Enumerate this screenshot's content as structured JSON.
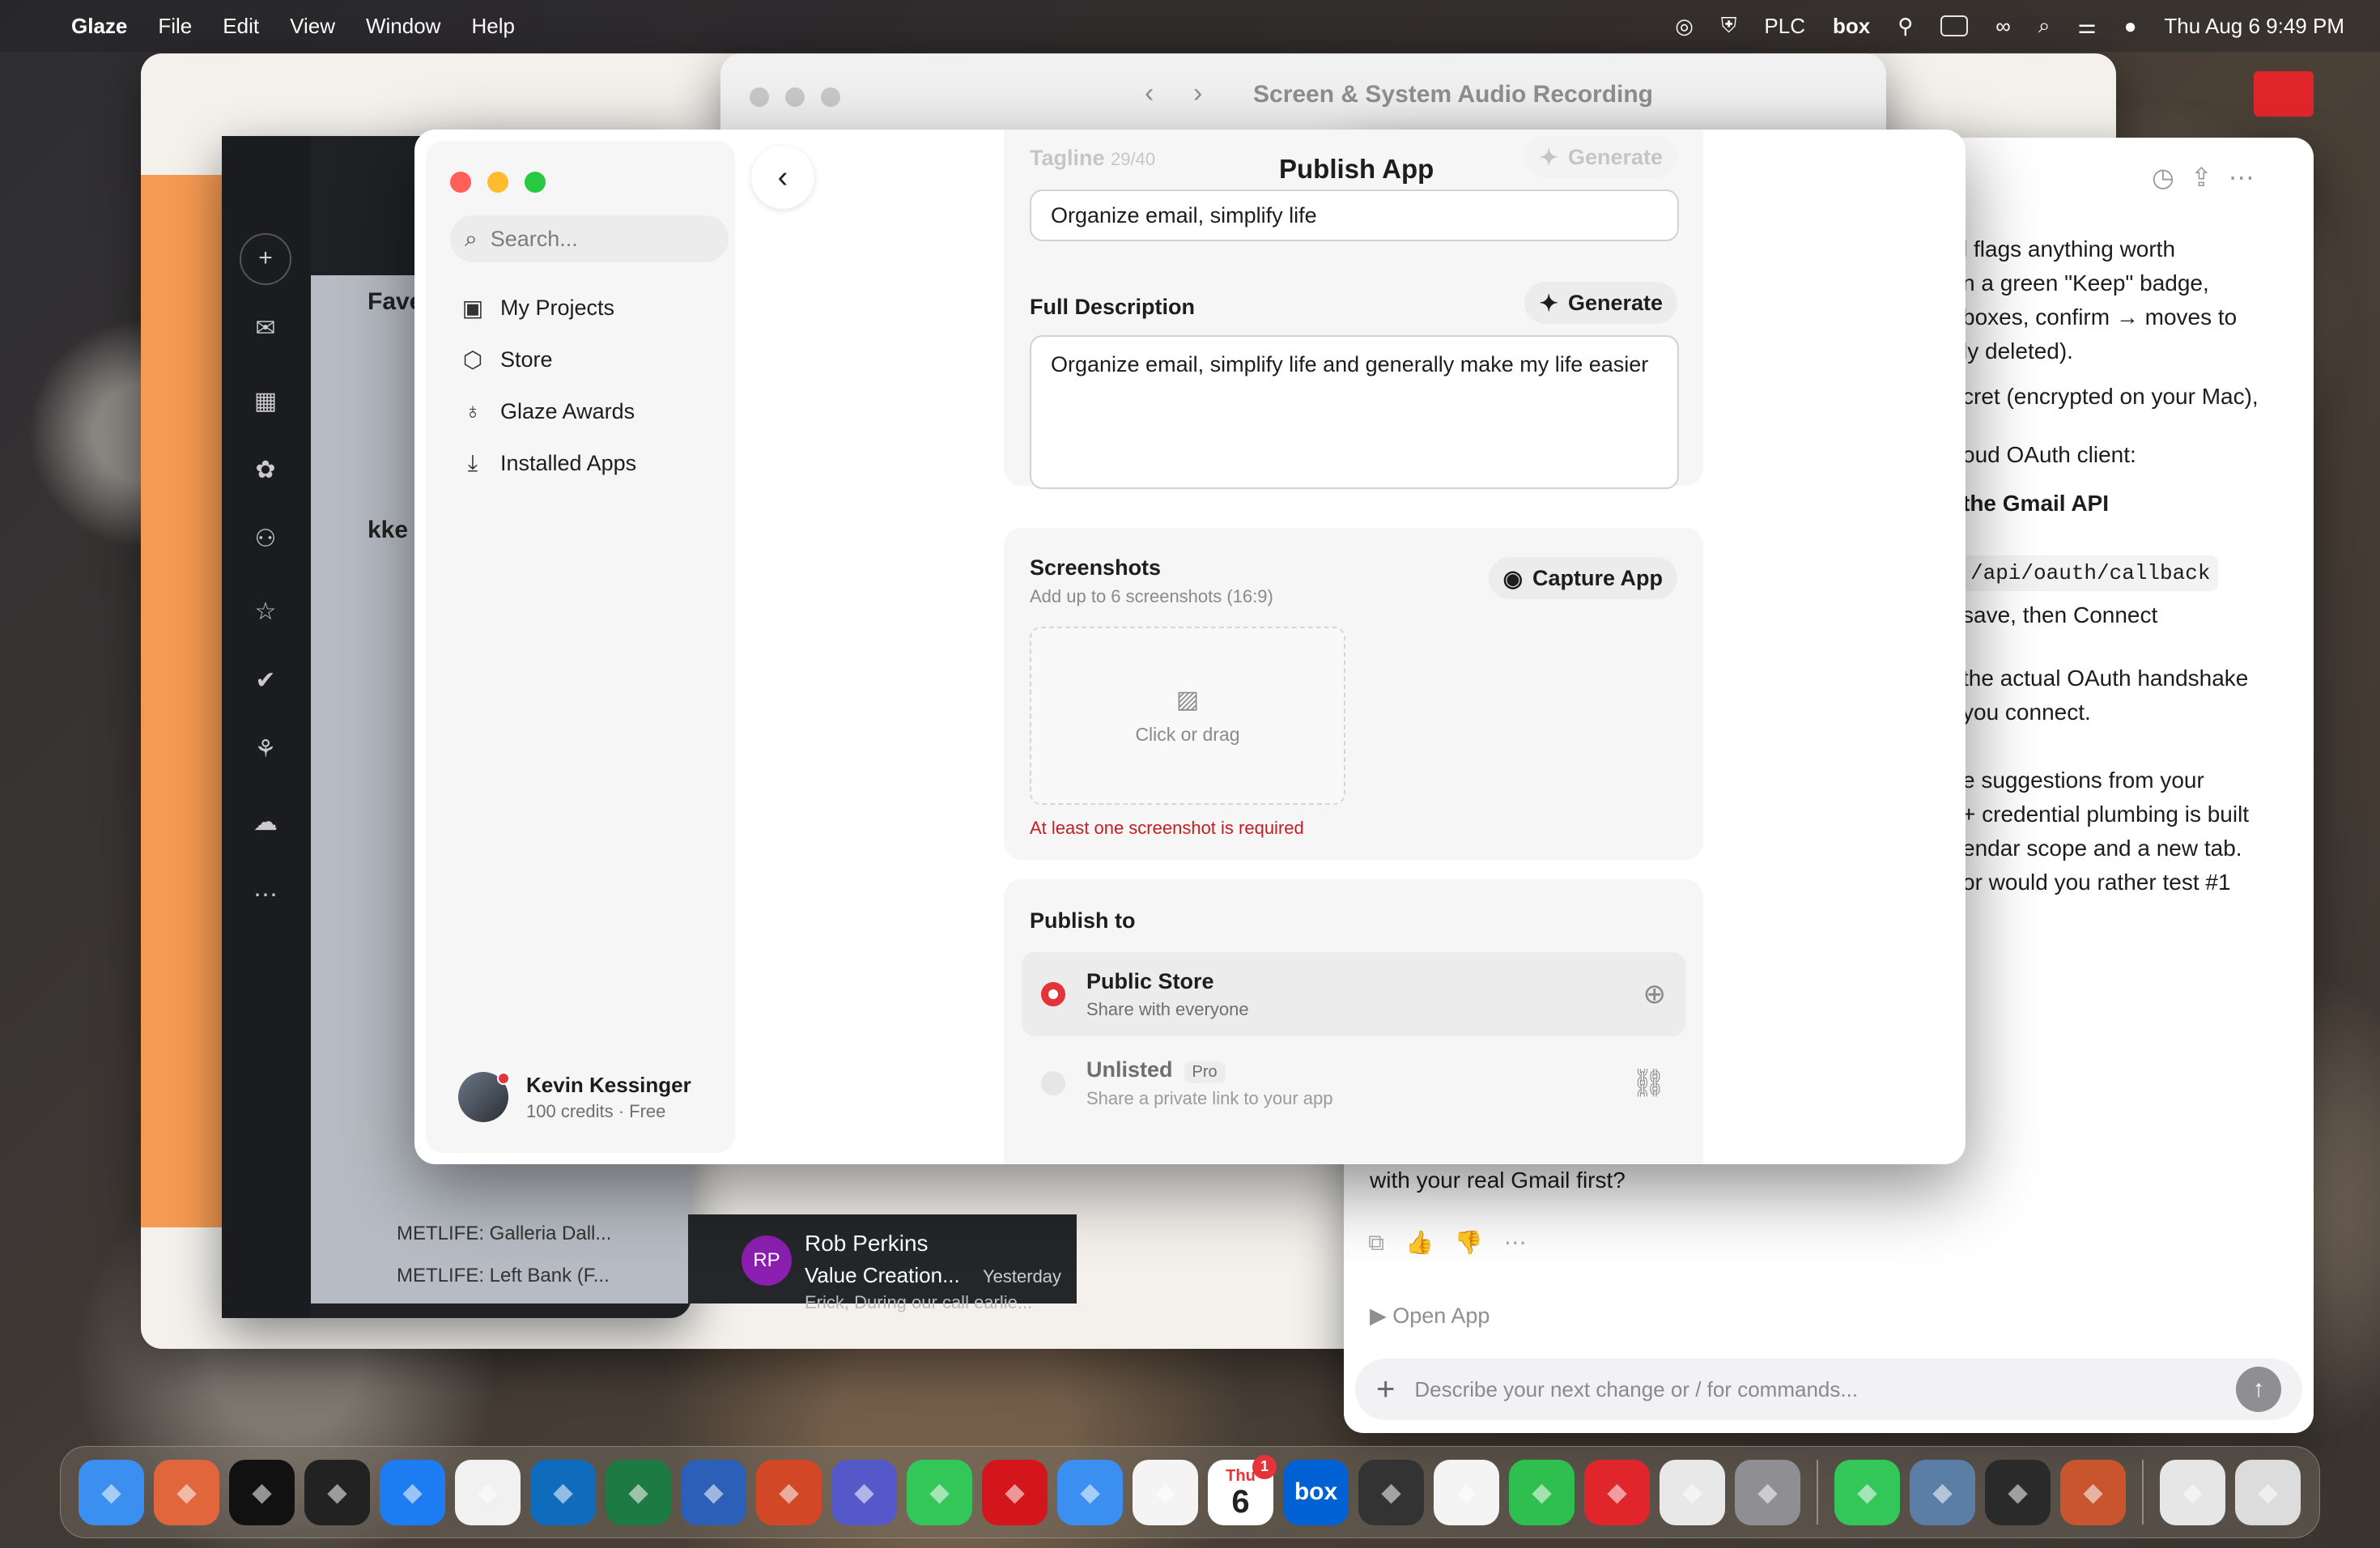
{
  "menubar": {
    "app": "Glaze",
    "items": [
      "File",
      "Edit",
      "View",
      "Window",
      "Help"
    ],
    "status": {
      "plc": "PLC",
      "box": "box",
      "datetime": "Thu Aug 6  9:49 PM"
    }
  },
  "recording_window": {
    "title": "Screen & System Audio Recording"
  },
  "chat_window": {
    "lines": [
      "l flags anything worth",
      "n a green \"Keep\" badge,",
      "boxes, confirm → moves to",
      "ly deleted).",
      "cret (encrypted on your Mac),",
      "oud OAuth client:",
      "the Gmail API",
      "/api/oauth/callback",
      "save, then Connect",
      "the actual OAuth handshake",
      " you connect.",
      "e suggestions from your",
      "+ credential plumbing is built",
      "endar scope and a new tab.",
      " or would you rather test #1"
    ],
    "last_line": "with your real Gmail first?",
    "open_app": "Open App",
    "input_placeholder": "Describe your next change or / for commands..."
  },
  "mail_window": {
    "favorites_label": "Fave",
    "account_label": "kke",
    "rows": [
      "METLIFE: Galleria Dall...",
      "METLIFE: Left Bank (F..."
    ],
    "preview": {
      "initials": "RP",
      "sender": "Rob Perkins",
      "subject": "Value Creation...",
      "time": "Yesterday",
      "snippet": "Erick, During our call earlie..."
    }
  },
  "glaze": {
    "search_placeholder": "Search...",
    "nav": [
      {
        "label": "My Projects",
        "icon": "projects-icon"
      },
      {
        "label": "Store",
        "icon": "store-box-icon"
      },
      {
        "label": "Glaze Awards",
        "icon": "award-ribbon-icon"
      },
      {
        "label": "Installed Apps",
        "icon": "download-icon"
      }
    ],
    "user": {
      "name": "Kevin Kessinger",
      "credits": "100 credits · Free"
    },
    "page_title": "Publish App",
    "tagline": {
      "label": "Tagline",
      "count": "29/40",
      "generate": "Generate",
      "value": "Organize email, simplify life"
    },
    "description": {
      "label": "Full Description",
      "generate": "Generate",
      "value": "Organize email, simplify life and generally make my life easier"
    },
    "screenshots": {
      "label": "Screenshots",
      "hint": "Add up to 6 screenshots (16:9)",
      "capture": "Capture App",
      "drop_label": "Click or drag",
      "error": "At least one screenshot is required"
    },
    "publish": {
      "label": "Publish to",
      "options": [
        {
          "title": "Public Store",
          "desc": "Share with everyone",
          "selected": true
        },
        {
          "title": "Unlisted",
          "badge": "Pro",
          "desc": "Share a private link to your app",
          "selected": false
        }
      ]
    },
    "accent_color": "#e5333a"
  },
  "dock": {
    "apps": [
      "Finder",
      "Claude",
      "ChatGPT",
      "Proton",
      "Safari",
      "Chrome",
      "Outlook",
      "Excel",
      "Word",
      "PowerPoint",
      "Teams",
      "Messages",
      "Acrobat",
      "Mail",
      "Reminders",
      "Calendar",
      "Box",
      "Calculator",
      "Photos",
      "Find My",
      "Quip",
      "Launchpad",
      "System Settings",
      "Phone",
      "Automator",
      "Glaze",
      "Preview",
      "Downloads",
      "Trash"
    ],
    "calendar_day": "6",
    "calendar_month": "Thu",
    "calendar_badge": "1",
    "box_label": "box"
  }
}
